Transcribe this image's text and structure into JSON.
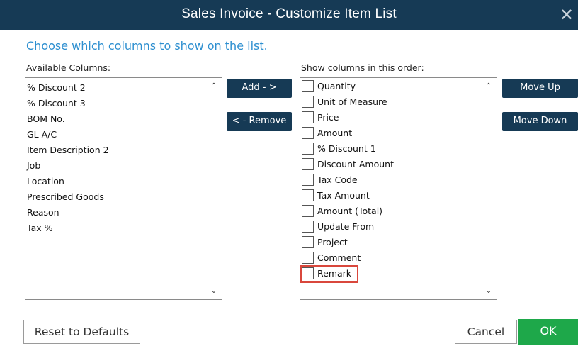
{
  "window": {
    "title": "Sales Invoice - Customize Item List",
    "close_glyph": "✕"
  },
  "heading": "Choose which columns to show on the list.",
  "available": {
    "label": "Available Columns:",
    "items": [
      "% Discount 2",
      "% Discount 3",
      "BOM No.",
      "GL A/C",
      "Item Description 2",
      "Job",
      "Location",
      "Prescribed Goods",
      "Reason",
      "Tax %"
    ]
  },
  "shown": {
    "label": "Show columns in this order:",
    "items": [
      {
        "label": "Quantity",
        "checked": false
      },
      {
        "label": "Unit of Measure",
        "checked": false
      },
      {
        "label": "Price",
        "checked": false
      },
      {
        "label": "Amount",
        "checked": false
      },
      {
        "label": "% Discount 1",
        "checked": false
      },
      {
        "label": "Discount Amount",
        "checked": false
      },
      {
        "label": "Tax Code",
        "checked": false
      },
      {
        "label": "Tax Amount",
        "checked": false
      },
      {
        "label": "Amount (Total)",
        "checked": false
      },
      {
        "label": "Update From",
        "checked": false
      },
      {
        "label": "Project",
        "checked": false
      },
      {
        "label": "Comment",
        "checked": false
      },
      {
        "label": "Remark",
        "checked": false,
        "highlighted": true
      }
    ]
  },
  "buttons": {
    "add": "Add - >",
    "remove": "< - Remove",
    "move_up": "Move Up",
    "move_down": "Move Down",
    "reset": "Reset to Defaults",
    "cancel": "Cancel",
    "ok": "OK"
  },
  "icons": {
    "scroll_up": "chevron-up-icon",
    "scroll_down": "chevron-down-icon"
  },
  "colors": {
    "titlebar": "#163a55",
    "heading": "#2d8fd0",
    "ok": "#1ea84a",
    "highlight": "#d9473c"
  }
}
